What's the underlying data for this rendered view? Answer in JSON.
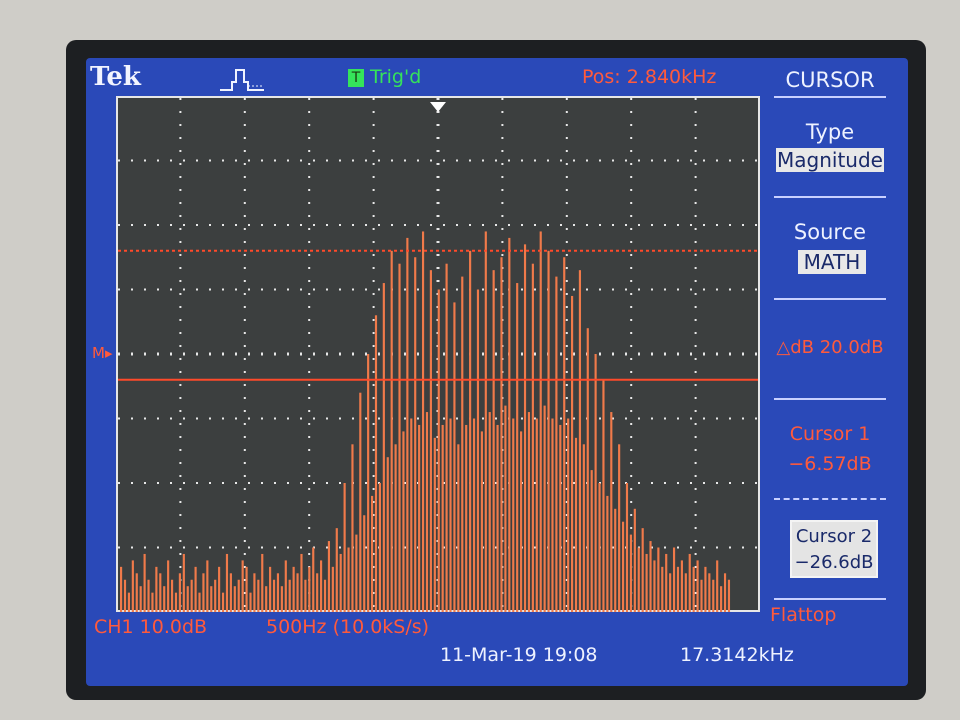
{
  "header": {
    "brand": "Tek",
    "trigger_icon": "trigger-pulse-icon",
    "trigger_status": "Trig'd",
    "position": "Pos: 2.840kHz"
  },
  "side_menu": {
    "title": "CURSOR",
    "type_label": "Type",
    "type_value": "Magnitude",
    "source_label": "Source",
    "source_value": "MATH",
    "delta": "△dB 20.0dB",
    "cursor1_label": "Cursor 1",
    "cursor1_value": "−6.57dB",
    "cursor2_label": "Cursor 2",
    "cursor2_value": "−26.6dB"
  },
  "footer": {
    "channel_scale": "CH1 10.0dB",
    "freq_scale": "500Hz (10.0kS/s)",
    "window": "Flattop",
    "datetime": "11-Mar-19 19:08",
    "frequency": "17.3142kHz"
  },
  "channel_marker": "M",
  "colors": {
    "screen_bg": "#2a49b8",
    "graticule_bg": "#3c3f3f",
    "trace": "#f07a4a",
    "cursor_line": "#ff4a2a",
    "text_red": "#ff5a3c",
    "text_white": "#eef2ff",
    "trig_green": "#35e35a"
  },
  "chart_data": {
    "type": "bar",
    "description_units": "dB per division, 10 div across, 8 div vertical",
    "x_range_hz": [
      0,
      5000
    ],
    "divisions": {
      "x": 10,
      "y": 8
    },
    "cursor1_div": 5.6,
    "cursor2_div": 3.6,
    "values": [
      0.7,
      0.5,
      0.3,
      0.8,
      0.6,
      0.4,
      0.9,
      0.5,
      0.3,
      0.7,
      0.6,
      0.4,
      0.8,
      0.5,
      0.3,
      0.6,
      0.9,
      0.4,
      0.5,
      0.7,
      0.3,
      0.6,
      0.8,
      0.4,
      0.5,
      0.7,
      0.3,
      0.9,
      0.6,
      0.4,
      0.5,
      0.8,
      0.7,
      0.3,
      0.6,
      0.5,
      0.9,
      0.4,
      0.7,
      0.5,
      0.6,
      0.4,
      0.8,
      0.5,
      0.7,
      0.6,
      0.9,
      0.5,
      0.7,
      1.0,
      0.6,
      0.8,
      0.5,
      1.1,
      0.7,
      1.3,
      0.9,
      2.0,
      1.0,
      2.6,
      1.2,
      3.4,
      1.5,
      4.0,
      1.8,
      4.6,
      2.0,
      5.1,
      2.4,
      5.6,
      2.6,
      5.4,
      2.8,
      5.8,
      3.0,
      5.5,
      2.9,
      5.9,
      3.1,
      5.3,
      2.7,
      5.0,
      2.9,
      5.4,
      3.0,
      4.8,
      2.6,
      5.2,
      2.9,
      5.6,
      3.0,
      5.0,
      2.8,
      5.9,
      3.1,
      5.3,
      2.9,
      5.5,
      3.2,
      5.8,
      3.0,
      5.1,
      2.8,
      5.7,
      3.1,
      5.4,
      3.0,
      5.9,
      3.2,
      5.6,
      3.0,
      5.2,
      2.9,
      5.5,
      3.0,
      4.9,
      2.7,
      5.3,
      2.6,
      4.4,
      2.2,
      4.0,
      2.0,
      3.6,
      1.8,
      3.1,
      1.6,
      2.6,
      1.4,
      2.0,
      1.2,
      1.6,
      1.0,
      1.3,
      0.9,
      1.1,
      0.8,
      1.0,
      0.7,
      0.9,
      0.6,
      1.0,
      0.7,
      0.8,
      0.6,
      0.9,
      0.7,
      0.8,
      0.5,
      0.7,
      0.6,
      0.5,
      0.8,
      0.4,
      0.6,
      0.5
    ]
  }
}
